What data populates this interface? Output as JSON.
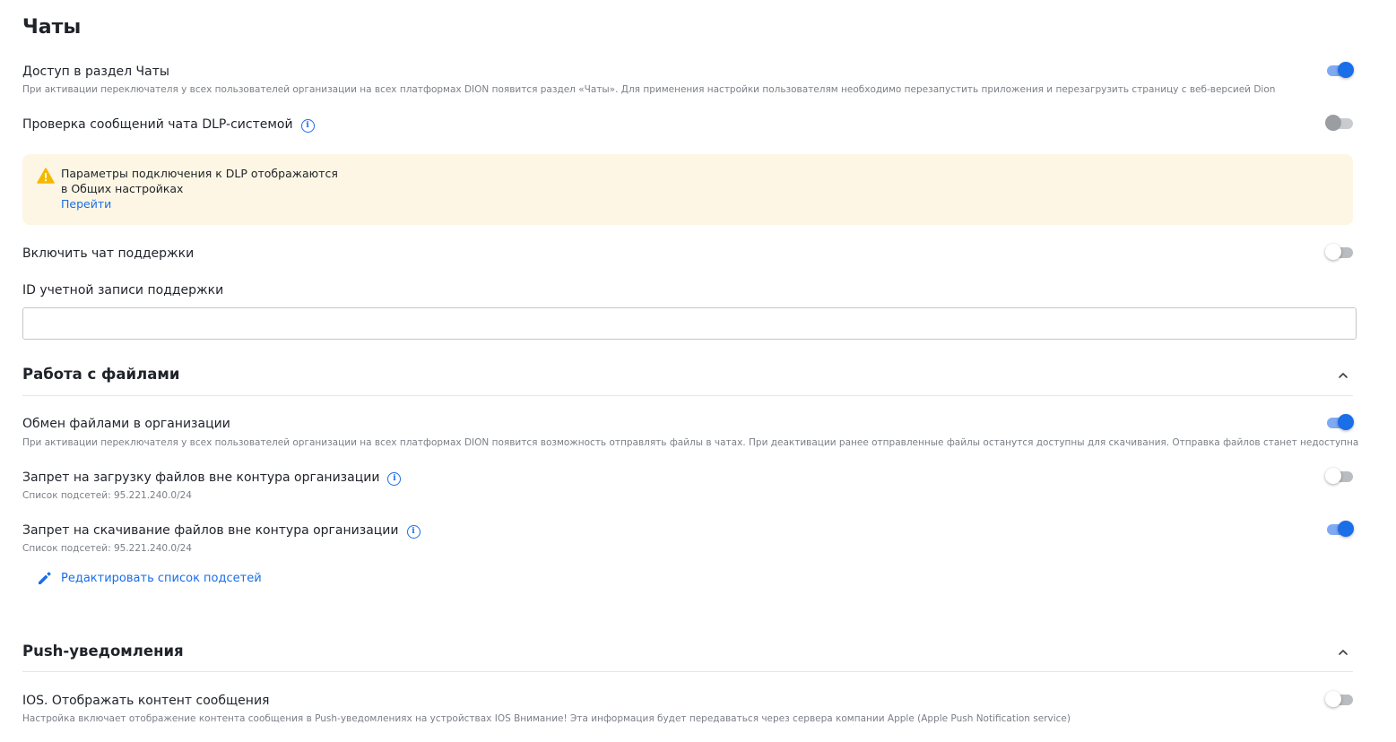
{
  "page": {
    "title": "Чаты"
  },
  "chats": {
    "access": {
      "label": "Доступ в раздел Чаты",
      "description": "При активации переключателя у всех пользователей организации на всех платформах DION появится раздел «Чаты». Для применения настройки пользователям необходимо перезапустить приложения и перезагрузить страницу с веб-версией Dion",
      "enabled": true
    },
    "dlp": {
      "label": "Проверка сообщений чата DLP-системой",
      "enabled": false,
      "disabled": true
    },
    "dlp_notice": {
      "line1": "Параметры подключения к DLP отображаются",
      "line2": "в Общих настройках",
      "link": "Перейти",
      "color": "#fdf6e4"
    },
    "support_chat": {
      "label": "Включить чат поддержки",
      "enabled": false
    },
    "support_id": {
      "label": "ID учетной записи поддержки",
      "value": "",
      "placeholder": ""
    }
  },
  "files": {
    "title": "Работа с файлами",
    "sharing": {
      "label": "Обмен файлами в организации",
      "description": "При активации переключателя у всех пользователей организации на всех платформах DION появится возможность отправлять файлы в чатах. При деактивации ранее отправленные файлы останутся доступны для скачивания. Отправка файлов станет недоступна",
      "enabled": true
    },
    "upload_ban": {
      "label": "Запрет на загрузку файлов вне контура организации",
      "subnets": "Список подсетей: 95.221.240.0/24",
      "enabled": false
    },
    "download_ban": {
      "label": "Запрет на скачивание файлов вне контура организации",
      "subnets": "Список подсетей: 95.221.240.0/24",
      "enabled": true
    },
    "edit_subnets": "Редактировать список подсетей"
  },
  "push": {
    "title": "Push-уведомления",
    "ios_content": {
      "label": "IOS. Отображать контент сообщения",
      "description": "Настройка включает отображение контента сообщения в Push-уведомлениях на устройствах IOS Внимание! Эта информация будет передаваться через сервера компании Apple (Apple Push Notification service)",
      "enabled": false
    }
  },
  "colors": {
    "accent": "#1a6ee8",
    "warning": "#f5b800"
  }
}
